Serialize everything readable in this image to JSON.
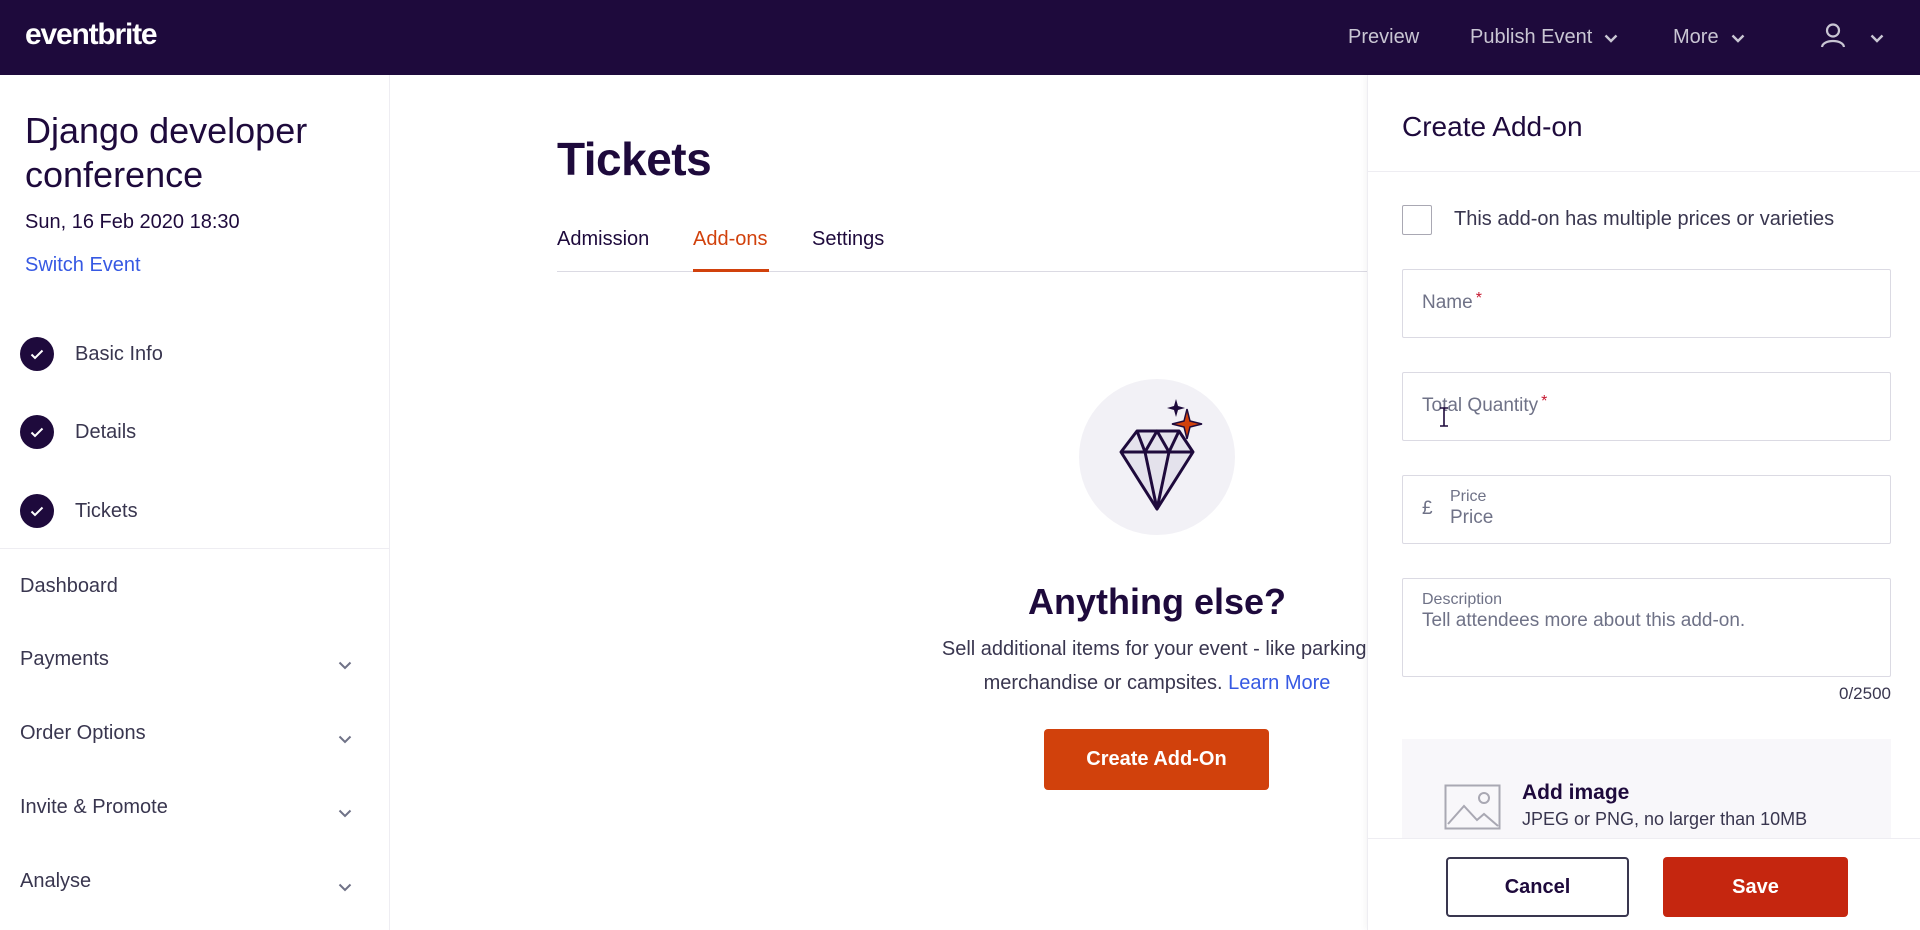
{
  "topbar": {
    "logo": "eventbrite",
    "preview": "Preview",
    "publish": "Publish Event",
    "more": "More",
    "user_icon": "user-icon",
    "background": "#1e0a3c"
  },
  "sidebar": {
    "event_title": "Django developer conference",
    "event_date": "Sun, 16 Feb 2020 18:30",
    "switch_event": "Switch Event",
    "steps": [
      {
        "label": "Basic Info",
        "icon": "check-icon"
      },
      {
        "label": "Details",
        "icon": "check-icon"
      },
      {
        "label": "Tickets",
        "icon": "check-icon"
      }
    ],
    "menu": [
      "Dashboard",
      "Payments",
      "Order Options",
      "Invite & Promote",
      "Analyse"
    ]
  },
  "main": {
    "title": "Tickets",
    "tabs": [
      {
        "label": "Admission",
        "active": false
      },
      {
        "label": "Add-ons",
        "active": true
      },
      {
        "label": "Settings",
        "active": false
      }
    ],
    "illustration": "diamond-icon",
    "empty_title": "Anything else?",
    "empty_desc": "Sell additional items for your event - like parking, merchandise or campsites.",
    "learn_more": "Learn More",
    "create_button": "Create Add-On",
    "accent": "#d1410c"
  },
  "panel": {
    "title": "Create Add-on",
    "checkbox_label": "This add-on has multiple prices or varieties",
    "name_placeholder": "Name",
    "quantity_placeholder": "Total Quantity",
    "required_mark": "*",
    "currency": "£",
    "price_label": "Price",
    "price_placeholder": "Price",
    "description_label": "Description",
    "description_placeholder": "Tell attendees more about this add-on.",
    "counter": "0/2500",
    "add_image_title": "Add image",
    "add_image_sub": "JPEG or PNG, no larger than 10MB",
    "cancel": "Cancel",
    "save": "Save",
    "save_color": "#c5260f"
  }
}
